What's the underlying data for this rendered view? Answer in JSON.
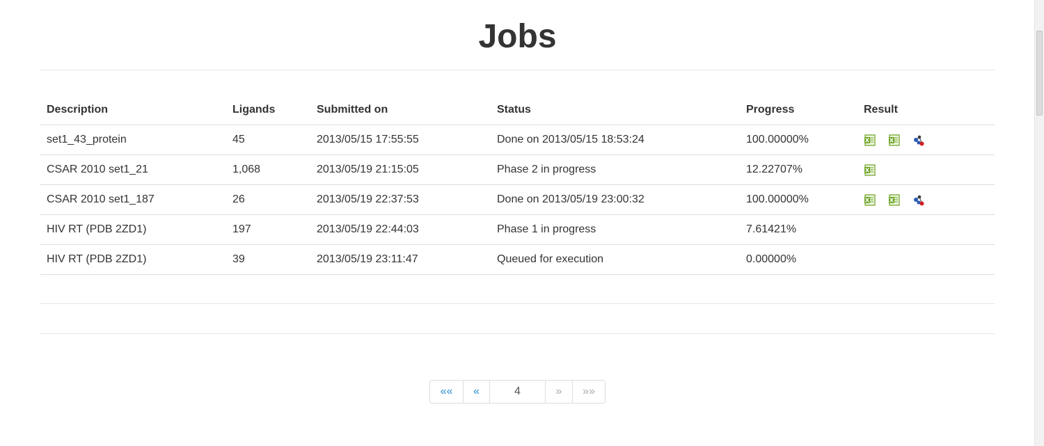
{
  "title": "Jobs",
  "table": {
    "headers": [
      "Description",
      "Ligands",
      "Submitted on",
      "Status",
      "Progress",
      "Result"
    ],
    "rows": [
      {
        "description": "set1_43_protein",
        "ligands": "45",
        "submitted": "2013/05/15 17:55:55",
        "status": "Done on 2013/05/15 18:53:24",
        "progress": "100.00000%",
        "results": [
          "excel-icon",
          "excel-icon",
          "molecule-icon"
        ]
      },
      {
        "description": "CSAR 2010 set1_21",
        "ligands": "1,068",
        "submitted": "2013/05/19 21:15:05",
        "status": "Phase 2 in progress",
        "progress": "12.22707%",
        "results": [
          "excel-icon"
        ]
      },
      {
        "description": "CSAR 2010 set1_187",
        "ligands": "26",
        "submitted": "2013/05/19 22:37:53",
        "status": "Done on 2013/05/19 23:00:32",
        "progress": "100.00000%",
        "results": [
          "excel-icon",
          "excel-icon",
          "molecule-icon"
        ]
      },
      {
        "description": "HIV RT (PDB 2ZD1)",
        "ligands": "197",
        "submitted": "2013/05/19 22:44:03",
        "status": "Phase 1 in progress",
        "progress": "7.61421%",
        "results": []
      },
      {
        "description": "HIV RT (PDB 2ZD1)",
        "ligands": "39",
        "submitted": "2013/05/19 23:11:47",
        "status": "Queued for execution",
        "progress": "0.00000%",
        "results": []
      }
    ]
  },
  "pagination": {
    "first_label": "««",
    "prev_label": "«",
    "page_value": "4",
    "next_label": "»",
    "last_label": "»»"
  },
  "colors": {
    "link": "#2a8dd4",
    "disabled": "#aaaaaa",
    "excel_green": "#6aa121",
    "molecule_blue": "#2a5bb5",
    "molecule_red": "#d01f1f"
  }
}
